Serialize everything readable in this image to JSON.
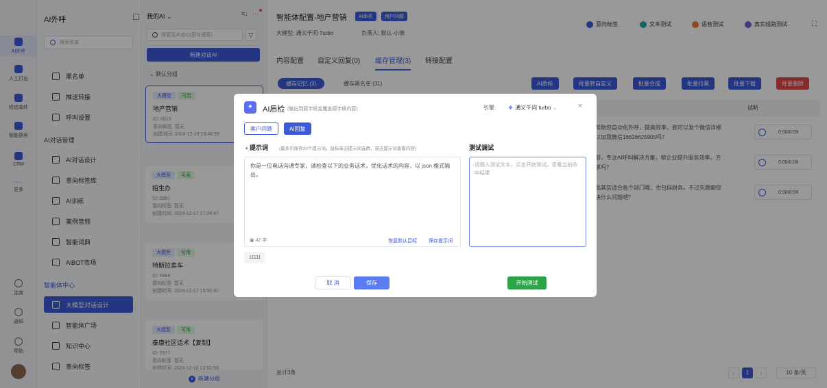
{
  "rail": {
    "items": [
      {
        "label": "AI外呼",
        "icon": "phone-icon"
      },
      {
        "label": "人工打出",
        "icon": "headset-icon"
      },
      {
        "label": "短信邮件",
        "icon": "message-icon"
      },
      {
        "label": "智能获客",
        "icon": "target-icon"
      },
      {
        "label": "CRM",
        "icon": "crm-icon"
      },
      {
        "label": "更多",
        "icon": "more-icon"
      }
    ],
    "bottom": [
      {
        "label": "坐席",
        "icon": "headset-icon"
      },
      {
        "label": "通知",
        "icon": "bell-icon"
      },
      {
        "label": "帮助",
        "icon": "help-icon"
      }
    ]
  },
  "nav": {
    "title": "AI外呼",
    "search_placeholder": "搜索菜单",
    "items_top": [
      "黑名单",
      "推送转接",
      "呼叫设置"
    ],
    "group1": "AI对话管理",
    "group1_items": [
      "AI对话设计",
      "意向标签库",
      "AI训练",
      "案例音频",
      "智能词典",
      "AiBOT市场"
    ],
    "group2": "智能体中心",
    "group2_items": [
      "大模型对话设计",
      "智能体广场",
      "知识中心",
      "意向标签"
    ]
  },
  "list": {
    "header": "我的AI",
    "search_placeholder": "搜索话术或ID(回车搜索)",
    "new_button": "新建对话AI",
    "group_label": "默认分组",
    "footer_button": "新建分组",
    "cards": [
      {
        "tag1": "大模型",
        "tag2": "可用",
        "title": "地产营销",
        "id": "ID: 6015",
        "intent": "意向标签",
        "intent_val": "暂无",
        "created": "创建时间: 2024-12-19 15:48:59"
      },
      {
        "tag1": "大模型",
        "tag2": "可用",
        "title": "招生办",
        "id": "ID: 5991",
        "intent": "意向标签",
        "intent_val": "暂无",
        "created": "创建时间: 2024-12-17 17:24:47"
      },
      {
        "tag1": "大模型",
        "tag2": "可用",
        "title": "特斯拉卖车",
        "id": "ID: 5989",
        "intent": "意向标签",
        "intent_val": "暂无",
        "created": "创建时间: 2024-12-17 15:50:40"
      },
      {
        "tag1": "大模型",
        "tag2": "可用",
        "title": "泰康社区话术【复制】",
        "id": "ID: 5977",
        "intent": "意向标签",
        "intent_val": "暂无",
        "created": "创建时间: 2024-12-16 13:52:59"
      }
    ]
  },
  "main": {
    "title": "智能体配置-地产营销",
    "badge1": "AI命名",
    "badge2": "用户问题",
    "model_label": "大模型:",
    "model_value": "通义千问 Turbo",
    "owner_label": "负责人:",
    "owner_value": "默认-小燕",
    "top_buttons": [
      "意向标签",
      "文本测试",
      "语音测试",
      "真实线路测试"
    ],
    "tabs": [
      "内容配置",
      "自定义回复(0)",
      "缓存管理(3)",
      "转接配置"
    ],
    "subtabs": [
      "缓存记忆 (3)",
      "缓存黑名单 (31)"
    ],
    "toolbar": [
      "AI质检",
      "批量转自定义",
      "批量合成",
      "批量拉黑",
      "批量下载",
      "批量删除"
    ],
    "col_listen": "试听",
    "rows": [
      {
        "line1": "帮助您自动化外呼，提高效率。我可以发个微信详细",
        "line2": "以加我微信18626625905吗？",
        "time": "0:00/0:09"
      },
      {
        "line1": "部，专注AI呼叫解决方案，帮企业提升服务效率。方",
        "line2": "求吗？",
        "time": "0:00/0:08"
      },
      {
        "line1": "品其实适合各个部门哦，也包括财务。不过先跟聊您",
        "line2": "决什么问题吧？",
        "time": "0:00/0:08"
      }
    ],
    "total": "总计3条",
    "page": "1",
    "page_size": "10 条/页"
  },
  "modal": {
    "title": "AI质检",
    "subtitle": "(输出到原字段变覆盖原字段内容)",
    "engine_label": "引擎:",
    "engine_value": "通义千问 turbo",
    "tabs": [
      "客户问题",
      "AI回复"
    ],
    "prompt_heading": "提示词",
    "prompt_hint": "(最多可保存20个提示词，鼠标单击提示词选用，双击提示词查看内容)",
    "prompt_text": "你是一位电话沟通专家，请检查以下的业务话术，优化话术的内容，以 json 格式输出。",
    "char_count": "42 字",
    "restore_link": "恢复默认目标",
    "save_prompt_link": "保存提示词",
    "saved_chip": "11111",
    "test_heading": "测试调试",
    "test_placeholder": "请输入测试文本，点击开始测试，查看当前命中结果",
    "cancel": "取 消",
    "save": "保存",
    "start_test": "开始测试"
  },
  "colors": {
    "accent": "#3d5bd9",
    "danger": "#e04848",
    "success": "#2ea34a"
  }
}
